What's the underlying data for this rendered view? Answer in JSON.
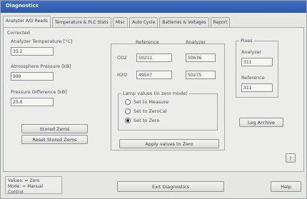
{
  "window": {
    "title": "Diagnostics"
  },
  "tabs": [
    "Analyzer A/D Reads",
    "Temperature & PLC Stats",
    "Misc",
    "Auto Cycle",
    "Batteries & Voltages",
    "Report"
  ],
  "active_tab": 0,
  "left": {
    "group_label": "Corrected",
    "analyzer_temp_label": "Analyzer Temperature [°C]",
    "analyzer_temp_value": "35.2",
    "atm_pressure_label": "Atmosphere Pressure [kB]",
    "atm_pressure_value": "999",
    "pressure_diff_label": "Pressure Difference [kB]",
    "pressure_diff_value": "25.0",
    "stored_zeros_label": "Stored Zeros",
    "reset_stored_zeros_label": "Reset Stored Zeros"
  },
  "middle": {
    "col_reference": "Reference",
    "col_analyzer": "Analyzer",
    "row1_label": "CO2",
    "row1_reference": "50211",
    "row1_analyzer": "50636",
    "row2_label": "H2O",
    "row2_reference": "49507",
    "row2_analyzer": "50275",
    "radio_group_title": "Lamp values (in zero mode)",
    "radio_options": [
      "Set to Measure",
      "Set to ZeroCal",
      "Set to Zero"
    ],
    "radio_selected": 2,
    "apply_button_label": "Apply values to Zero"
  },
  "right": {
    "group_label": "Pixes",
    "analyzer_label": "Analyzer",
    "analyzer_value": "311",
    "reference_label": "Reference",
    "reference_value": "311",
    "log_button_label": "Log Archive",
    "small_button_label": "?"
  },
  "bottom": {
    "status_line1": "Values: = Zero",
    "status_line2": "Mode: = Manual Control",
    "exit_button_label": "Exit Diagnostics",
    "help_button_label": "Help"
  }
}
